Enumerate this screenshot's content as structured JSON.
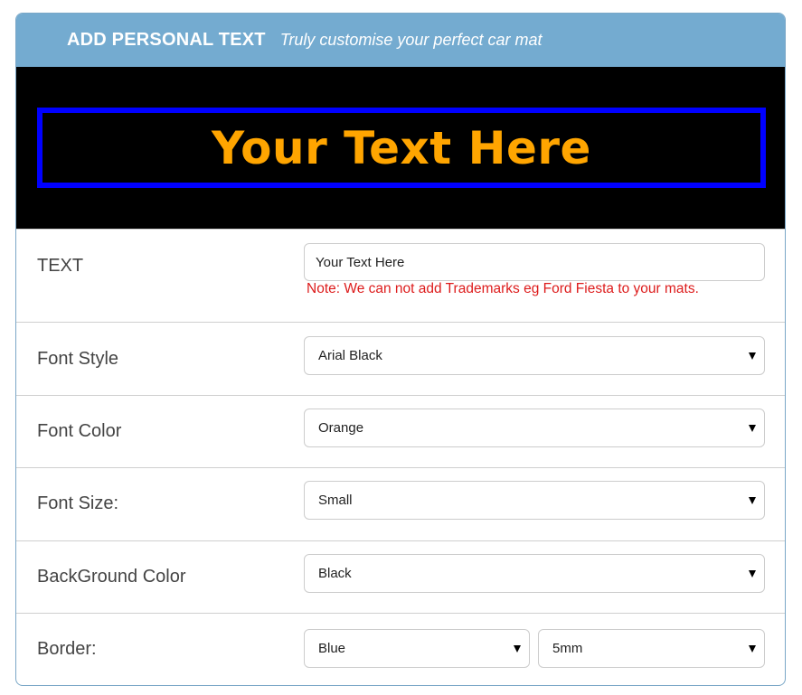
{
  "header": {
    "title": "ADD PERSONAL TEXT",
    "subtitle": "Truly customise your perfect car mat"
  },
  "preview": {
    "text": "Your Text Here",
    "font_color": "#ffa500",
    "background_color": "#000000",
    "border_color": "#0000ff"
  },
  "fields": {
    "text": {
      "label": "TEXT",
      "value": "Your Text Here",
      "note": "Note: We can not add Trademarks eg Ford Fiesta to your mats."
    },
    "font_style": {
      "label": "Font Style",
      "value": "Arial Black"
    },
    "font_color": {
      "label": "Font Color",
      "value": "Orange"
    },
    "font_size": {
      "label": "Font Size:",
      "value": "Small"
    },
    "background_color": {
      "label": "BackGround Color",
      "value": "Black"
    },
    "border": {
      "label": "Border:",
      "color_value": "Blue",
      "size_value": "5mm"
    }
  },
  "icons": {
    "select_arrow": "caret-down-icon"
  }
}
